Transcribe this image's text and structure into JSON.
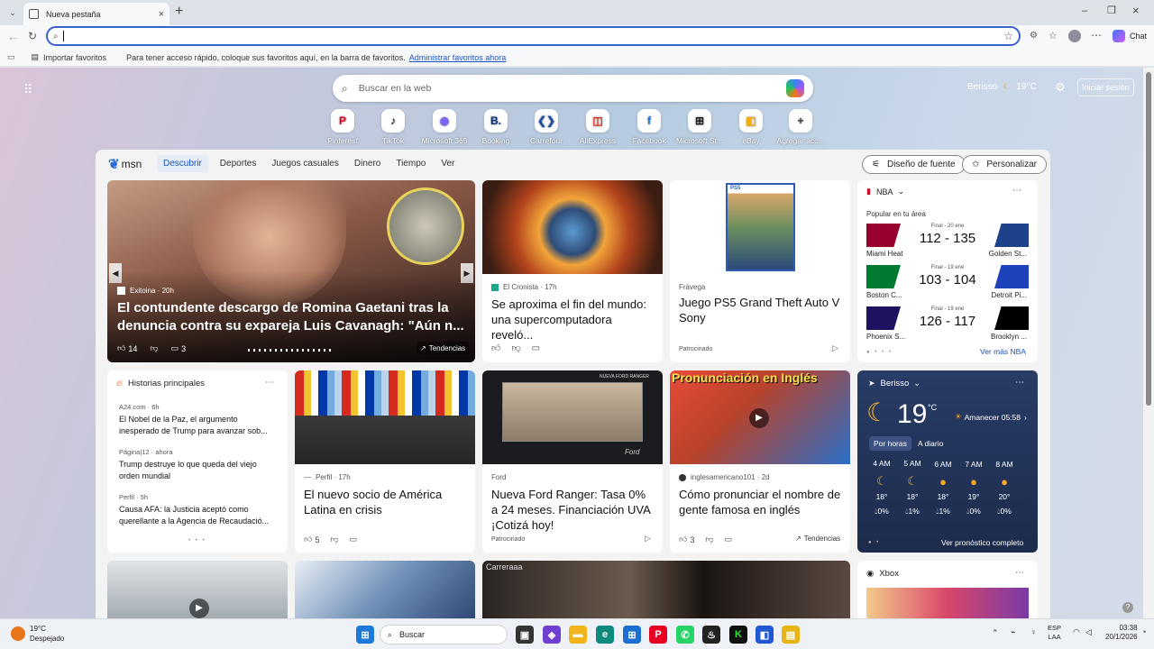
{
  "browser": {
    "tab_title": "Nueva pestaña",
    "address_value": "",
    "fav_import": "Importar favoritos",
    "fav_hint": "Para tener acceso rápido, coloque sus favoritos aquí, en la barra de favoritos.",
    "fav_manage": "Administrar favoritos ahora",
    "chat_label": "Chat"
  },
  "newtab": {
    "search_placeholder": "Buscar en la web",
    "location": "Berisso",
    "temperature": "19°C",
    "signin_label": "Iniciar sesión",
    "quicklinks": [
      {
        "label": "Pinterest",
        "icon": "pinterest-icon",
        "glyph": "P",
        "color": "#e60023"
      },
      {
        "label": "TikTok",
        "icon": "tiktok-icon",
        "glyph": "♪",
        "color": "#111111"
      },
      {
        "label": "Microsoft 365",
        "icon": "m365-icon",
        "glyph": "◉",
        "color": "#7b61ff"
      },
      {
        "label": "Booking",
        "icon": "booking-icon",
        "glyph": "B.",
        "color": "#003580"
      },
      {
        "label": "Carrefour",
        "icon": "carrefour-icon",
        "glyph": "❮❯",
        "color": "#1e4fa0"
      },
      {
        "label": "AliExpress",
        "icon": "aliexpress-icon",
        "glyph": "◫",
        "color": "#e43225"
      },
      {
        "label": "Facebook",
        "icon": "facebook-icon",
        "glyph": "f",
        "color": "#1877f2"
      },
      {
        "label": "Microsoft St...",
        "icon": "store-icon",
        "glyph": "⊞",
        "color": "#222222"
      },
      {
        "label": "eBay",
        "icon": "ebay-icon",
        "glyph": "◧",
        "color": "#f5af02"
      },
      {
        "label": "Agregar acc...",
        "icon": "plus-icon",
        "glyph": "+",
        "color": "#444444"
      }
    ]
  },
  "feed": {
    "logo": "msn",
    "nav": [
      "Descubrir",
      "Deportes",
      "Juegos casuales",
      "Dinero",
      "Tiempo",
      "Ver"
    ],
    "font_button": "Diseño de fuente",
    "personalize_button": "Personalizar",
    "hero": {
      "source": "Exitoina · 20h",
      "title": "El contundente descargo de Romina Gaetani tras la denuncia contra su expareja Luis Cavanagh: \"Aún n...",
      "likes": "14",
      "comments": "3",
      "trend": "Tendencias"
    },
    "card_super": {
      "source": "El Cronista · 17h",
      "title": "Se aproxima el fin del mundo: una supercomputadora reveló..."
    },
    "card_gta": {
      "source": "Frávega",
      "title": "Juego PS5 Grand Theft Auto V Sony",
      "sponsored": "Patrocinado",
      "cover_label": "PS5"
    },
    "nba": {
      "title": "NBA",
      "subtitle": "Popular en tu área",
      "games": [
        {
          "status": "Final - 20 ene",
          "score": "112 - 135",
          "home": "Miami Heat",
          "away": "Golden St...",
          "home_color": "#98002e",
          "away_color": "#1d428a"
        },
        {
          "status": "Final - 19 ene",
          "score": "103 - 104",
          "home": "Boston C...",
          "away": "Detroit Pi...",
          "home_color": "#007a33",
          "away_color": "#1d42ba"
        },
        {
          "status": "Final - 19 ene",
          "score": "126 - 117",
          "home": "Phoenix S...",
          "away": "Brooklyn ...",
          "home_color": "#1d1160",
          "away_color": "#000000"
        }
      ],
      "more": "Ver más NBA"
    },
    "top_stories": {
      "title": "Historias principales",
      "items": [
        {
          "source": "A24.com · 6h",
          "title": "El Nobel de la Paz, el argumento inesperado de Trump para avanzar sob..."
        },
        {
          "source": "Página|12 · ahora",
          "title": "Trump destruye lo que queda del viejo orden mundial"
        },
        {
          "source": "Perfil · 5h",
          "title": "Causa AFA: la Justicia aceptó como querellante a la Agencia de Recaudació..."
        }
      ]
    },
    "card_latam": {
      "source": "Perfil · 17h",
      "title": "El nuevo socio de América Latina en crisis",
      "likes": "5"
    },
    "card_ford": {
      "source": "Ford",
      "title": "Nueva Ford Ranger: Tasa 0% a 24 meses. Financiación UVA ¡Cotizá hoy!",
      "sponsored": "Patrocinado",
      "banner_label": "NUEVA FORD RANGER",
      "logo": "Ford"
    },
    "card_english": {
      "source": "inglesamericano101 · 2d",
      "title": "Cómo pronunciar el nombre de gente famosa en inglés",
      "likes": "3",
      "trend": "Tendencias",
      "overlay": "Pronunciación en Inglés"
    },
    "weather": {
      "location": "Berisso",
      "temp": "19",
      "unit": "°C",
      "sunrise": "Amanecer 05:58",
      "tabs": [
        "Por horas",
        "A diario"
      ],
      "hours": [
        {
          "time": "4 AM",
          "icon": "moon-icon",
          "temp": "18°",
          "rain": "0%"
        },
        {
          "time": "5 AM",
          "icon": "moon-icon",
          "temp": "18°",
          "rain": "1%"
        },
        {
          "time": "6 AM",
          "icon": "sun-icon",
          "temp": "18°",
          "rain": "1%"
        },
        {
          "time": "7 AM",
          "icon": "sun-icon",
          "temp": "19°",
          "rain": "0%"
        },
        {
          "time": "8 AM",
          "icon": "sun-icon",
          "temp": "20°",
          "rain": "0%"
        }
      ],
      "more": "Ver pronóstico completo"
    },
    "bottom_label": "Carreraaa",
    "xbox_title": "Xbox"
  },
  "taskbar": {
    "weather_temp": "19°C",
    "weather_desc": "Despejado",
    "search": "Buscar",
    "lang1": "ESP",
    "lang2": "LAA",
    "time": "03:38",
    "date": "20/1/2026"
  },
  "colors": {
    "accent": "#3a62c9",
    "weather_bg": "#263a63",
    "hero_bg": "#6b4a3e"
  }
}
